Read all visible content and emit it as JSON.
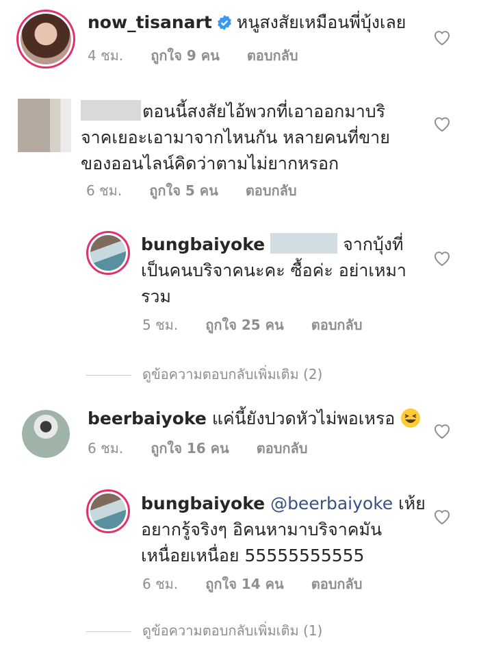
{
  "comments": [
    {
      "username": "now_tisanart",
      "verified": true,
      "text": "หนูสงสัยเหมือนพี่บุ้งเลย",
      "time": "4 ชม.",
      "likes": "ถูกใจ 9 คน",
      "reply": "ตอบกลับ"
    },
    {
      "username": "",
      "text_line1": "ตอนนี้สงสัยไอ้พวกที่เอาออกมาบริ",
      "text_line2": "จาคเยอะเอามาจากไหนกัน หลายคนที่ขาย",
      "text_line3": "ของออนไลน์คิดว่าตามไม่ยากหรอก",
      "time": "6 ชม.",
      "likes": "ถูกใจ 5 คน",
      "reply": "ตอบกลับ"
    },
    {
      "username": "bungbaiyoke",
      "text_line1": "จากบุ้งที่",
      "text_line2": "เป็นคนบริจาคนะคะ ซื้อค่ะ อย่าเหมา",
      "text_line3": "รวม",
      "time": "5 ชม.",
      "likes": "ถูกใจ 25 คน",
      "reply": "ตอบกลับ",
      "view_replies": "ดูข้อความตอบกลับเพิ่มเติม (2)"
    },
    {
      "username": "beerbaiyoke",
      "text": "แค่นี้ยังปวดหัวไม่พอเหรอ",
      "time": "6 ชม.",
      "likes": "ถูกใจ 16 คน",
      "reply": "ตอบกลับ"
    },
    {
      "username": "bungbaiyoke",
      "mention": "@beerbaiyoke",
      "text_line1": "เห้ย",
      "text_line2": "อยากรู้จริงๆ อิคนหามาบริจาคมัน",
      "text_line3": "เหนื่อยเหนื่อย 55555555555",
      "time": "6 ชม.",
      "likes": "ถูกใจ 14 คน",
      "reply": "ตอบกลับ",
      "view_replies": "ดูข้อความตอบกลับเพิ่มเติม (1)"
    }
  ],
  "icons": {
    "like": "heart-outline-icon",
    "verified": "verified-badge-icon",
    "emoji": "laughing-emoji-icon"
  },
  "colors": {
    "text": "#262626",
    "meta": "#8e8e8e",
    "verified": "#3897f0",
    "mention": "#385185",
    "story_ring": "#e1306c"
  }
}
